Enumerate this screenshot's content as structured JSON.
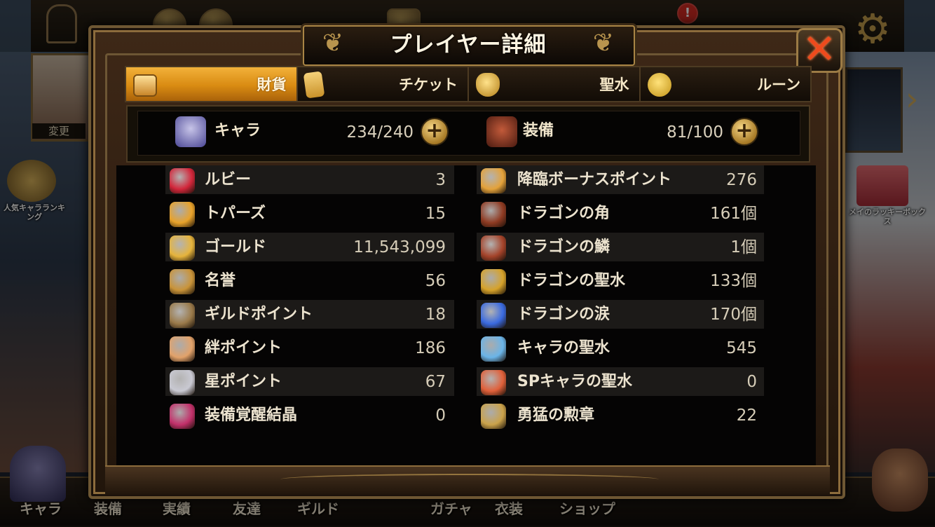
{
  "dialog": {
    "title": "プレイヤー詳細",
    "close_symbol": "✕"
  },
  "tabs": [
    {
      "label": "財貨",
      "icon": "treasure-chest-icon",
      "active": true
    },
    {
      "label": "チケット",
      "icon": "ticket-icon",
      "active": false
    },
    {
      "label": "聖水",
      "icon": "holy-water-icon",
      "active": false
    },
    {
      "label": "ルーン",
      "icon": "rune-icon",
      "active": false
    }
  ],
  "capacity": {
    "chara": {
      "label": "キャラ",
      "value": "234/240",
      "icon": "character-icon"
    },
    "equip": {
      "label": "装備",
      "value": "81/100",
      "icon": "equipment-icon"
    },
    "plus_symbol": "+"
  },
  "items_left": [
    {
      "label": "ルビー",
      "value": "3",
      "icon": "ruby-icon",
      "color": "#d2263a"
    },
    {
      "label": "トパーズ",
      "value": "15",
      "icon": "topaz-icon",
      "color": "#e8a22a"
    },
    {
      "label": "ゴールド",
      "value": "11,543,099",
      "icon": "gold-coin-icon",
      "color": "#e6b43c"
    },
    {
      "label": "名誉",
      "value": "56",
      "icon": "honor-icon",
      "color": "#c99338"
    },
    {
      "label": "ギルドポイント",
      "value": "18",
      "icon": "guild-point-icon",
      "color": "#9a7a4a"
    },
    {
      "label": "絆ポイント",
      "value": "186",
      "icon": "bond-point-icon",
      "color": "#e2a26a"
    },
    {
      "label": "星ポイント",
      "value": "67",
      "icon": "star-point-icon",
      "color": "#c9c9d2"
    },
    {
      "label": "装備覚醒結晶",
      "value": "0",
      "icon": "awakening-crystal-icon",
      "color": "#c2306a"
    }
  ],
  "items_right": [
    {
      "label": "降臨ボーナスポイント",
      "value": "276",
      "icon": "advent-bonus-icon",
      "color": "#e4a23a"
    },
    {
      "label": "ドラゴンの角",
      "value": "161個",
      "icon": "dragon-horn-icon",
      "color": "#8e3a22"
    },
    {
      "label": "ドラゴンの鱗",
      "value": "1個",
      "icon": "dragon-scale-icon",
      "color": "#a4432a"
    },
    {
      "label": "ドラゴンの聖水",
      "value": "133個",
      "icon": "dragon-holy-water-icon",
      "color": "#d6a22a"
    },
    {
      "label": "ドラゴンの涙",
      "value": "170個",
      "icon": "dragon-tear-icon",
      "color": "#3a6ae0"
    },
    {
      "label": "キャラの聖水",
      "value": "545",
      "icon": "chara-holy-water-icon",
      "color": "#6ab4e8"
    },
    {
      "label": "SPキャラの聖水",
      "value": "0",
      "icon": "sp-chara-holy-water-icon",
      "color": "#e0603a"
    },
    {
      "label": "勇猛の勲章",
      "value": "22",
      "icon": "valor-medal-icon",
      "color": "#caa24a"
    }
  ],
  "background": {
    "thumb_label": "変更",
    "rank_label": "人気キャラランキング",
    "lucky_label": "メイのラッキーボックス",
    "nav": [
      "キャラ",
      "装備",
      "実績",
      "友達",
      "ギルド",
      "ガチャ",
      "衣装",
      "ショップ"
    ]
  },
  "colors": {
    "tab_active": "#e39a1c",
    "frame": "#6e5733",
    "close_x": "#ef4a1d"
  }
}
